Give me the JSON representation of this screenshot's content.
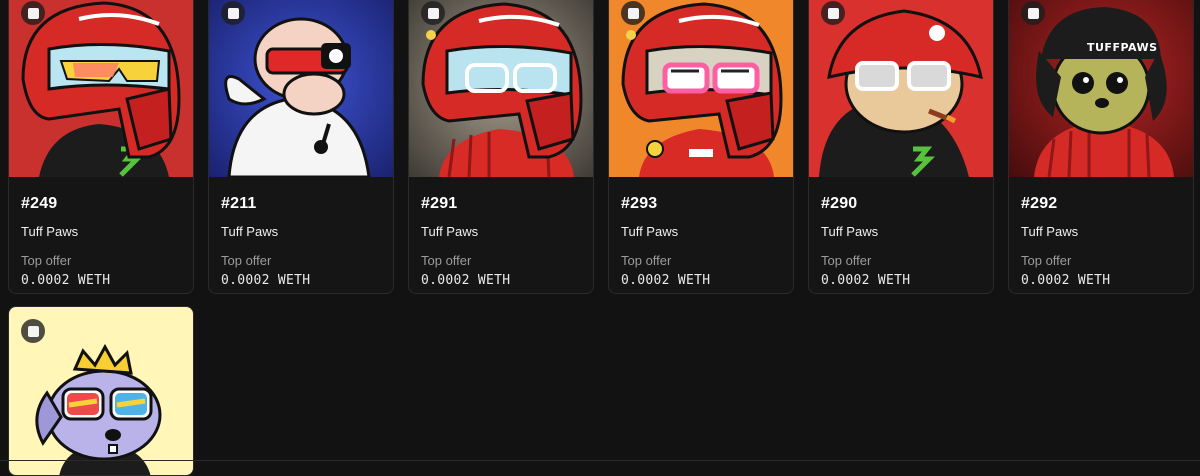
{
  "items": [
    {
      "id": "#249",
      "collection": "Tuff Paws",
      "offer_label": "Top offer",
      "offer_value": "0.0002 WETH",
      "bg": "#c9312f"
    },
    {
      "id": "#211",
      "collection": "Tuff Paws",
      "offer_label": "Top offer",
      "offer_value": "0.0002 WETH",
      "bg": "#2d3a9f"
    },
    {
      "id": "#291",
      "collection": "Tuff Paws",
      "offer_label": "Top offer",
      "offer_value": "0.0002 WETH",
      "bg": "#7b7568"
    },
    {
      "id": "#293",
      "collection": "Tuff Paws",
      "offer_label": "Top offer",
      "offer_value": "0.0002 WETH",
      "bg": "#f0882b"
    },
    {
      "id": "#290",
      "collection": "Tuff Paws",
      "offer_label": "Top offer",
      "offer_value": "0.0002 WETH",
      "bg": "#d9312d"
    },
    {
      "id": "#292",
      "collection": "Tuff Paws",
      "offer_label": "Top offer",
      "offer_value": "0.0002 WETH",
      "bg": "#8f1d1d",
      "hat_text": "TUFFPAWS"
    },
    {
      "bg": "#fff6b8"
    }
  ]
}
